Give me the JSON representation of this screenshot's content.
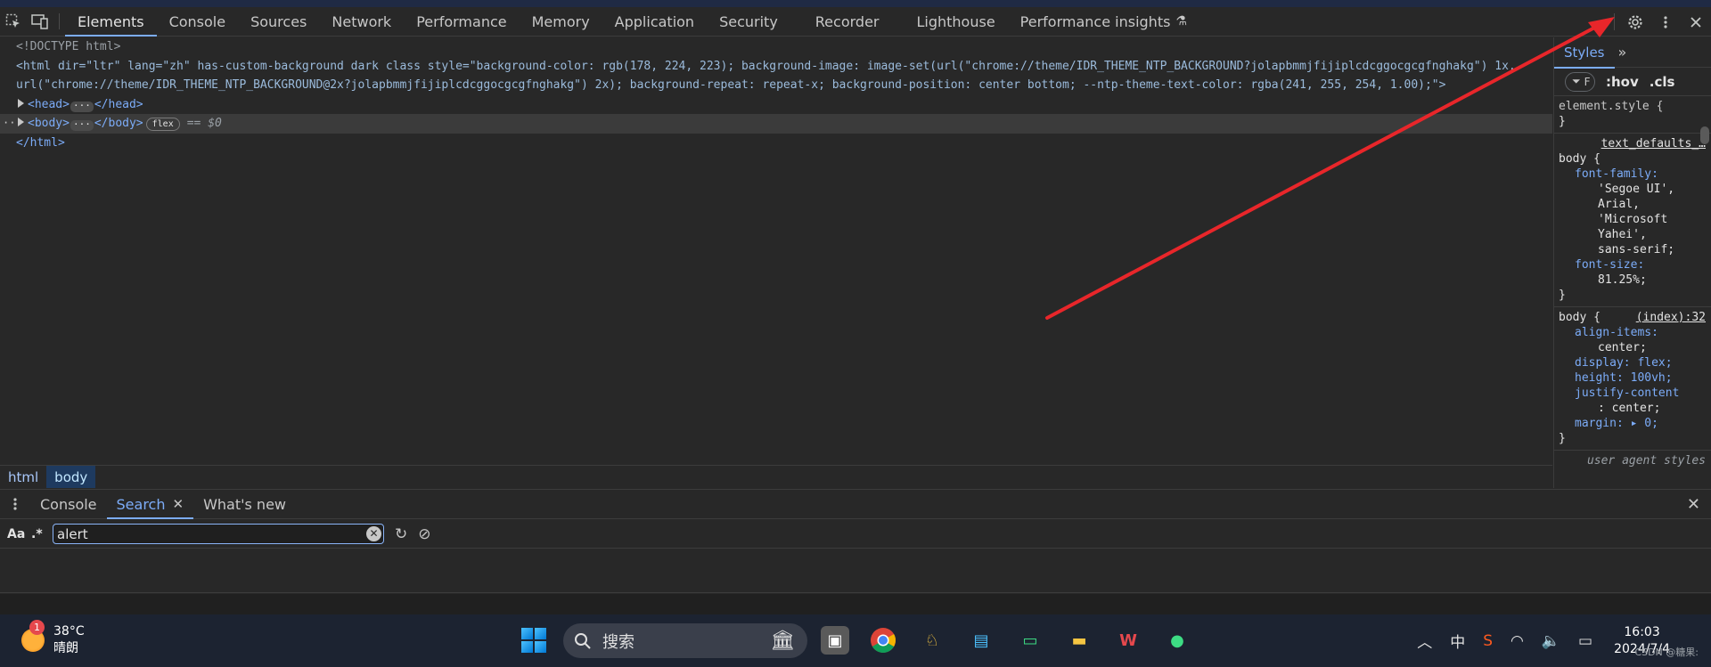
{
  "toolbar": {
    "tabs": [
      "Elements",
      "Console",
      "Sources",
      "Network",
      "Performance",
      "Memory",
      "Application",
      "Security",
      "Recorder",
      "Lighthouse",
      "Performance insights"
    ]
  },
  "elements": {
    "doctype": "<!DOCTYPE html>",
    "html_open_1": "<html dir=\"ltr\" lang=\"zh\" has-custom-background dark class style=\"background-color: rgb(178, 224, 223); background-image: image-set(url(\"chrome://theme/IDR_THEME_NTP_BACKGROUND?jolapbmmjfijiplcdcggocgcgfnghakg\") 1x,",
    "html_open_2": "url(\"chrome://theme/IDR_THEME_NTP_BACKGROUND@2x?jolapbmmjfijiplcdcggocgcgfnghakg\") 2x); background-repeat: repeat-x; background-position: center bottom; --ntp-theme-text-color: rgba(241, 255, 254, 1.00);\">",
    "head_open": "<head>",
    "head_close": "</head>",
    "body_open": "<body>",
    "body_close": "</body>",
    "flex_badge": "flex",
    "eq_sel": "== $0",
    "html_close": "</html>"
  },
  "breadcrumb": [
    "html",
    "body"
  ],
  "styles": {
    "tab": "Styles",
    "filter_placeholder": "F",
    "hov": ":hov",
    "cls": ".cls",
    "rule1": "element.style {",
    "rule1_close": "}",
    "rule2_src": "text_defaults_…",
    "rule2_sel": "body {",
    "ff_prop": "font-family:",
    "ff_vals": [
      "'Segoe UI',",
      "Arial,",
      "'Microsoft",
      "Yahei',",
      "sans-serif;"
    ],
    "fs_prop": "font-size:",
    "fs_val": "81.25%;",
    "rule2_close": "}",
    "rule3_sel": "body {",
    "rule3_src": "(index):32",
    "ai_prop": "align-items:",
    "ai_val": "center;",
    "display_line": "display: flex;",
    "height_line": "height: 100vh;",
    "jc_prop": "justify-content",
    "jc_val": ": center;",
    "margin_line": "margin: ▸ 0;",
    "rule3_close": "}",
    "ua": "user agent styles"
  },
  "drawer": {
    "tabs": [
      "Console",
      "Search",
      "What's new"
    ],
    "search_case": "Aa",
    "search_regex": ".*",
    "search_value": "alert"
  },
  "taskbar": {
    "badge": "1",
    "temp": "38°C",
    "weather": "晴朗",
    "search_text": "搜索",
    "tray_ime": "中",
    "time": "16:03",
    "date": "2024/7/4",
    "watermark": "CSDN @糖果:"
  },
  "colors": {
    "accent": "#7cacf8",
    "arrow": "#e8262a",
    "panel": "#282828"
  }
}
